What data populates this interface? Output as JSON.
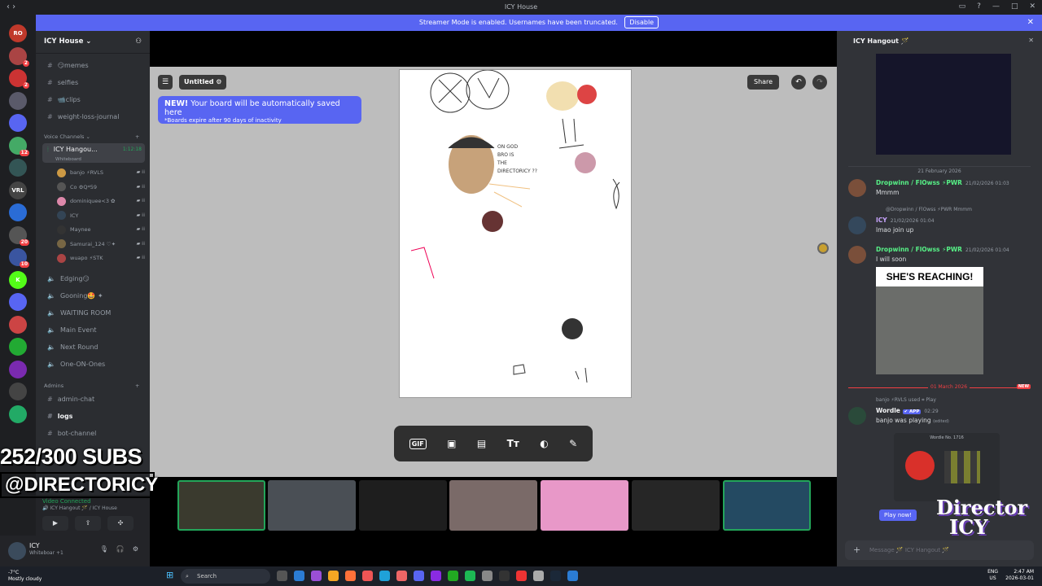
{
  "window": {
    "title": "ICY House"
  },
  "banner": {
    "text": "Streamer Mode is enabled. Usernames have been truncated.",
    "disable_label": "Disable"
  },
  "servers": [
    {
      "label": "RO",
      "badge": "",
      "color": "#c0392b"
    },
    {
      "label": "",
      "badge": "2",
      "color": "#a44"
    },
    {
      "label": "",
      "badge": "2",
      "color": "#c33"
    },
    {
      "label": "",
      "badge": "",
      "color": "#5a5a6a"
    },
    {
      "label": "",
      "badge": "",
      "color": "#5865f2"
    },
    {
      "label": "",
      "badge": "12",
      "color": "#4a6"
    },
    {
      "label": "",
      "badge": "",
      "color": "#355"
    },
    {
      "label": "VRL",
      "badge": "",
      "color": "#444"
    },
    {
      "label": "",
      "badge": "",
      "color": "#2a6cd6"
    },
    {
      "label": "",
      "badge": "20",
      "color": "#555"
    },
    {
      "label": "",
      "badge": "10",
      "color": "#3a55a0"
    },
    {
      "label": "K",
      "badge": "",
      "color": "#53fc18"
    },
    {
      "label": "",
      "badge": "",
      "color": "#5865f2"
    },
    {
      "label": "",
      "badge": "",
      "color": "#c44"
    },
    {
      "label": "",
      "badge": "",
      "color": "#2a3"
    },
    {
      "label": "",
      "badge": "",
      "color": "#7a2ab0"
    },
    {
      "label": "",
      "badge": "",
      "color": "#444"
    },
    {
      "label": "",
      "badge": "",
      "color": "#2a6"
    }
  ],
  "guild": {
    "name": "ICY House ⌄",
    "text_channels": [
      "😏memes",
      "selfies",
      "📹clips",
      "weight-loss-journal"
    ],
    "voice_category": "Voice Channels ⌄",
    "active_voice": {
      "name": "ICY Hangou...",
      "timer": "1:12:18",
      "sub": "Whiteboard"
    },
    "voice_users": [
      {
        "name": "banjo ⚡RVLS",
        "color": "#c94"
      },
      {
        "name": "Co ⚙Q*59",
        "color": "#555"
      },
      {
        "name": "dominiquee<3 ✿",
        "color": "#d8a"
      },
      {
        "name": "ICY",
        "color": "#345"
      },
      {
        "name": "Maynee",
        "color": "#333"
      },
      {
        "name": "Samurai_124 ♡✦",
        "color": "#764"
      },
      {
        "name": "wuapo ⚡STK",
        "color": "#a44"
      }
    ],
    "other_voice": [
      "Edging😏",
      "Gooning🤩 ✦",
      "WAITING ROOM",
      "Main Event",
      "Next Round",
      "One-ON-Ones"
    ],
    "admin_category": "Admins",
    "admin_channels": [
      "admin-chat",
      "logs",
      "bot-channel"
    ]
  },
  "overlay": {
    "subs": "252/300 SUBS",
    "handle": "@DIRECTORICY"
  },
  "voicebar": {
    "status": "Video Connected",
    "sub": "🔊 ICY Hangout 🪄 / ICY House"
  },
  "user": {
    "name": "ICY",
    "status": "Whiteboar +1"
  },
  "board": {
    "title": "Untitled ⚙",
    "notice_new": "NEW!",
    "notice_main": " Your board will be automatically saved here",
    "notice_sub": "*Boards expire after 90 days of inactivity",
    "share": "Share"
  },
  "chat": {
    "channel": "ICY Hangout 🪄",
    "date1": "21 February 2026",
    "messages": [
      {
        "name": "Dropwinn / FlOwss ⚡PWR",
        "time": "21/02/2026 01:03",
        "text": "Mmmm"
      },
      {
        "reply": "@Dropwinn / FlOwss ⚡PWR  Mmmm",
        "name": "ICY",
        "time": "21/02/2026 01:04",
        "text": "lmao join up"
      },
      {
        "name": "Dropwinn / FlOwss ⚡PWR",
        "time": "21/02/2026 01:04",
        "text": "I will soon"
      }
    ],
    "gif_caption": "SHE'S REACHING!",
    "date2": "01 March 2026",
    "new_label": "NEW",
    "used_line": "banjo ⚡RVLS  used  ⌗ Play",
    "bot_name": "Wordle",
    "bot_tag": "✔ APP",
    "bot_time": "02:29",
    "bot_text": "banjo was playing",
    "edited": "(edited)",
    "wordle_no": "Wordle No. 1716",
    "play_button": "Play now!",
    "input_placeholder": "Message 🪄 ICY Hangout 🪄"
  },
  "taskbar": {
    "weather_temp": "-7°C",
    "weather_desc": "Mostly cloudy",
    "search": "Search",
    "lang1": "ENG",
    "lang2": "US",
    "time": "2:47 AM",
    "date": "2026-03-01"
  },
  "watermark": {
    "line1": "Director",
    "line2": "ICY"
  }
}
